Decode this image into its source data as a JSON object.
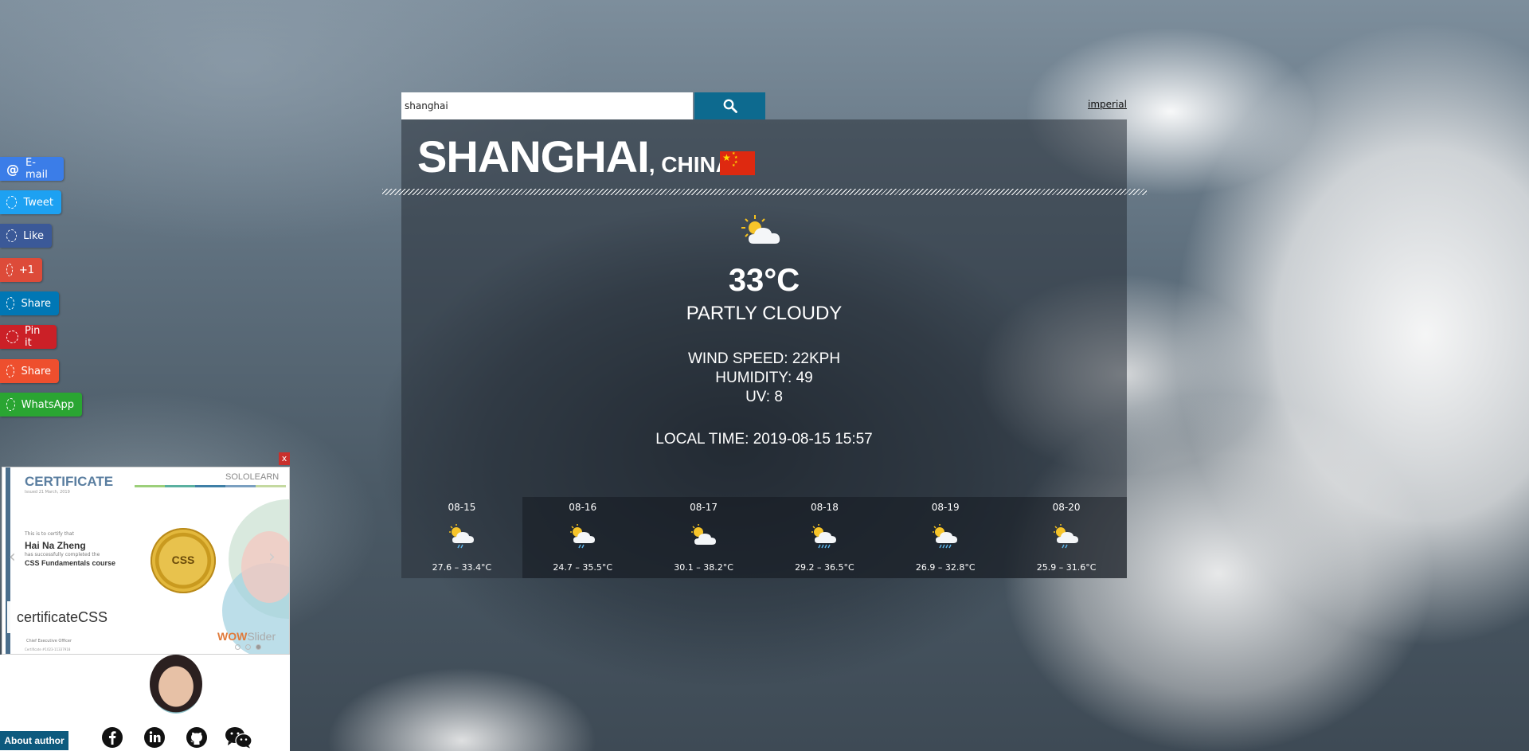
{
  "search": {
    "value": "shanghai",
    "button_icon": "search-icon"
  },
  "unit_toggle": "imperial",
  "location": {
    "city": "SHANGHAI",
    "country": ", CHINA",
    "flag": "china-flag"
  },
  "current": {
    "icon": "partly-cloudy-icon",
    "temperature": "33°C",
    "condition": "PARTLY CLOUDY",
    "wind": "WIND SPEED: 22KPH",
    "humidity": "HUMIDITY: 49",
    "uv": "UV: 8",
    "local_time": "LOCAL TIME: 2019-08-15 15:57"
  },
  "forecast": [
    {
      "date": "08-15",
      "range": "27.6 – 33.4°C",
      "icon": "partly-cloudy-rain-icon"
    },
    {
      "date": "08-16",
      "range": "24.7 – 35.5°C",
      "icon": "partly-cloudy-rain-icon"
    },
    {
      "date": "08-17",
      "range": "30.1 – 38.2°C",
      "icon": "partly-cloudy-icon"
    },
    {
      "date": "08-18",
      "range": "29.2 – 36.5°C",
      "icon": "partly-cloudy-heavy-rain-icon"
    },
    {
      "date": "08-19",
      "range": "26.9 – 32.8°C",
      "icon": "partly-cloudy-heavy-rain-icon"
    },
    {
      "date": "08-20",
      "range": "25.9 – 31.6°C",
      "icon": "partly-cloudy-rain-icon"
    }
  ],
  "share_buttons": [
    {
      "label": "E-mail",
      "color": "#3b7de8",
      "icon": "at-icon"
    },
    {
      "label": "Tweet",
      "color": "#1da1f2",
      "icon": "dashed-circle-icon"
    },
    {
      "label": "Like",
      "color": "#3b5998",
      "icon": "dashed-circle-icon"
    },
    {
      "label": "+1",
      "color": "#dd4b39",
      "icon": "dashed-circle-icon"
    },
    {
      "label": "Share",
      "color": "#0077b5",
      "icon": "dashed-circle-icon"
    },
    {
      "label": "Pin it",
      "color": "#cb2027",
      "icon": "dashed-circle-icon"
    },
    {
      "label": "Share",
      "color": "#ee4f2e",
      "icon": "dashed-circle-icon"
    },
    {
      "label": "WhatsApp",
      "color": "#2aa532",
      "icon": "dashed-circle-icon"
    }
  ],
  "certificate": {
    "close": "x",
    "title": "CERTIFICATE",
    "brand": "SOLOLEARN",
    "issued": "Issued 21 March, 2019",
    "certify": "This is to certify that",
    "holder": "Hai Na Zheng",
    "completed": "has successfully completed the",
    "course": "CSS Fundamentals course",
    "seal_text": "CSS",
    "caption": "certificateCSS",
    "slider_brand_a": "WOW",
    "slider_brand_b": "Slider",
    "exec": "Chief Executive Officer",
    "cert_no": "Certificate #1023-11337918"
  },
  "author": {
    "about_label": "About author",
    "social": [
      "facebook-icon",
      "linkedin-icon",
      "github-icon",
      "wechat-icon"
    ]
  },
  "colors": {
    "accent": "#0d6a8f",
    "panel": "rgba(40,48,56,.55)"
  }
}
